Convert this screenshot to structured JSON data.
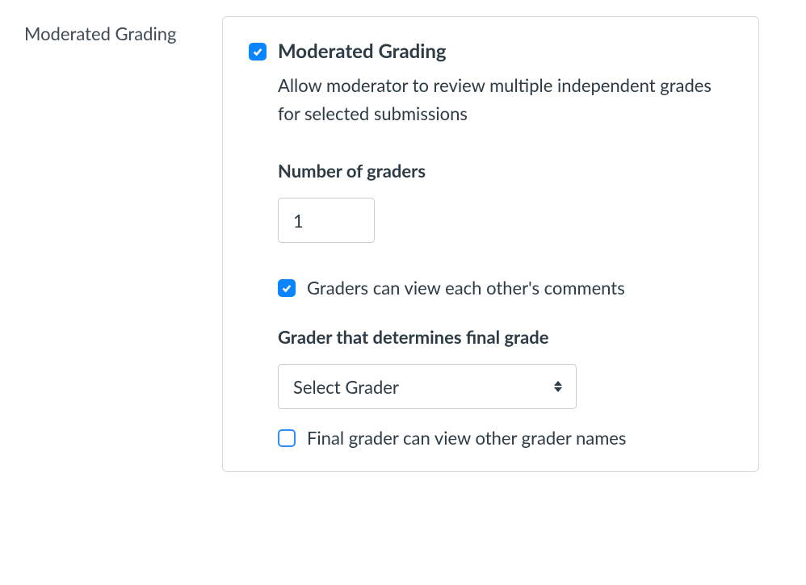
{
  "leftLabel": "Moderated Grading",
  "moderated": {
    "checked": true,
    "title": "Moderated Grading",
    "description": "Allow moderator to review multiple independent grades for selected submissions"
  },
  "numGraders": {
    "label": "Number of graders",
    "value": "1"
  },
  "gradersViewComments": {
    "checked": true,
    "label": "Graders can view each other's comments"
  },
  "finalGrader": {
    "label": "Grader that determines final grade",
    "selected": "Select Grader"
  },
  "finalGraderViewNames": {
    "checked": false,
    "label": "Final grader can view other grader names"
  }
}
